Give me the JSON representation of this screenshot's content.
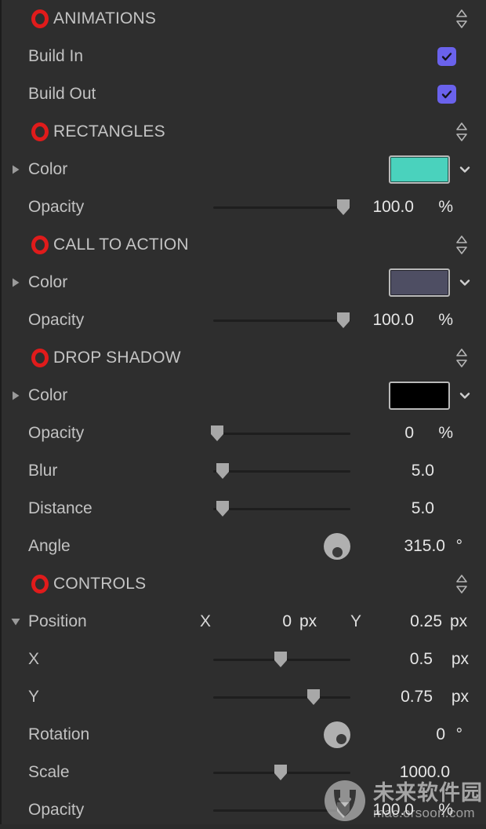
{
  "panel": {
    "background_color": "#2e2e2e",
    "accent_checkbox_color": "#6a62ec",
    "record_indicator_color": "#e01b1b"
  },
  "sections": [
    {
      "id": "animations",
      "title": "ANIMATIONS",
      "icon": "record-circle-icon",
      "sort_icon": "up-down-chevrons-icon"
    },
    {
      "id": "rectangles",
      "title": "RECTANGLES",
      "icon": "record-circle-icon",
      "sort_icon": "up-down-chevrons-icon"
    },
    {
      "id": "call-to-action",
      "title": "CALL TO ACTION",
      "icon": "record-circle-icon",
      "sort_icon": "up-down-chevrons-icon"
    },
    {
      "id": "drop-shadow",
      "title": "DROP SHADOW",
      "icon": "record-circle-icon",
      "sort_icon": "up-down-chevrons-icon"
    },
    {
      "id": "controls",
      "title": "CONTROLS",
      "icon": "record-circle-icon",
      "sort_icon": "up-down-chevrons-icon"
    }
  ],
  "rows": {
    "build_in": {
      "label": "Build In",
      "checked": true
    },
    "build_out": {
      "label": "Build Out",
      "checked": true
    },
    "rect_color": {
      "label": "Color",
      "swatch": "#4ad2bd",
      "disclosure": "collapsed",
      "chevron": "chevron-down-icon"
    },
    "rect_opacity": {
      "label": "Opacity",
      "value": "100.0",
      "unit": "%",
      "slider_percent": 95
    },
    "cta_color": {
      "label": "Color",
      "swatch": "#4e4e63",
      "disclosure": "collapsed",
      "chevron": "chevron-down-icon"
    },
    "cta_opacity": {
      "label": "Opacity",
      "value": "100.0",
      "unit": "%",
      "slider_percent": 95
    },
    "ds_color": {
      "label": "Color",
      "swatch": "#000000",
      "disclosure": "collapsed",
      "chevron": "chevron-down-icon"
    },
    "ds_opacity": {
      "label": "Opacity",
      "value": "0",
      "unit": "%",
      "slider_percent": 3
    },
    "ds_blur": {
      "label": "Blur",
      "value": "5.0",
      "unit": "",
      "slider_percent": 7
    },
    "ds_distance": {
      "label": "Distance",
      "value": "5.0",
      "unit": "",
      "slider_percent": 7
    },
    "ds_angle": {
      "label": "Angle",
      "value": "315.0",
      "unit": "°",
      "dial_angle": 315
    },
    "position": {
      "label": "Position",
      "disclosure": "expanded",
      "x_label": "X",
      "x_value": "0",
      "x_unit": "px",
      "y_label": "Y",
      "y_value": "0.25",
      "y_unit": "px"
    },
    "position_x": {
      "label": "X",
      "value": "0.5",
      "unit": "px",
      "slider_percent": 49
    },
    "position_y": {
      "label": "Y",
      "value": "0.75",
      "unit": "px",
      "slider_percent": 73
    },
    "rotation": {
      "label": "Rotation",
      "value": "0",
      "unit": "°",
      "dial_angle": 0
    },
    "scale": {
      "label": "Scale",
      "value": "1000.0",
      "unit": "",
      "slider_percent": 49
    },
    "opacity_last": {
      "label": "Opacity",
      "value": "100.0",
      "unit": "%",
      "slider_percent": 95
    }
  },
  "watermark": {
    "brand_cn": "未来软件园",
    "url": "mac.orsoon.com",
    "logo": "orsoon-logo-icon"
  }
}
